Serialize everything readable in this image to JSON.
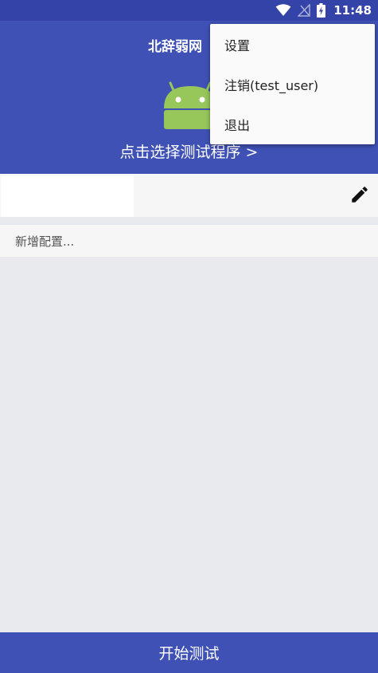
{
  "status_bar": {
    "time": "11:48",
    "icons": [
      "wifi-icon",
      "no-signal-icon",
      "battery-charging-icon"
    ]
  },
  "app_bar": {
    "title": "北辞弱网",
    "choose_program": "点击选择测试程序 >",
    "logo_icon": "android-icon"
  },
  "config": {
    "edit_icon": "pencil-icon",
    "new_config": "新增配置..."
  },
  "start_button": "开始测试",
  "menu": {
    "items": [
      {
        "label": "设置"
      },
      {
        "label": "注销(test_user)"
      },
      {
        "label": "退出"
      }
    ]
  },
  "colors": {
    "primary": "#3f51b5",
    "status_bar": "#3443a7",
    "background": "#e9eaee",
    "android_green": "#97c65a"
  }
}
